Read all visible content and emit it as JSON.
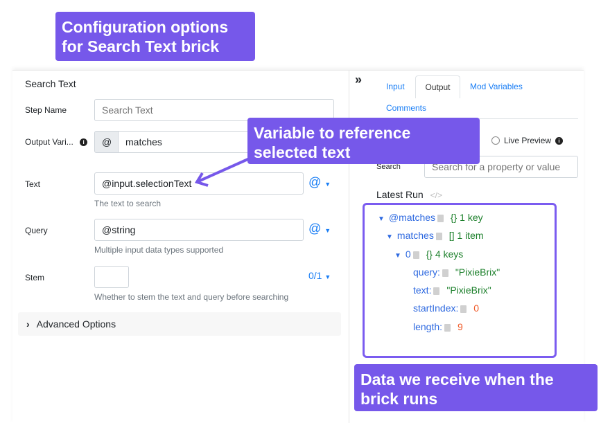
{
  "annotations": {
    "config": "Configuration options for Search Text brick",
    "variable": "Variable to reference selected text",
    "data": "Data we receive when the brick runs"
  },
  "brick": {
    "title": "Search Text",
    "fields": {
      "step_name": {
        "label": "Step Name",
        "placeholder": "Search Text"
      },
      "output_var": {
        "label": "Output Vari...",
        "prefix": "@",
        "value": "matches"
      },
      "text": {
        "label": "Text",
        "value": "@input.selectionText",
        "help": "The text to search",
        "type_button": "@"
      },
      "query": {
        "label": "Query",
        "value": "@string",
        "help": "Multiple input data types supported",
        "type_button": "@"
      },
      "stem": {
        "label": "Stem",
        "help": "Whether to stem the text and query before searching",
        "type_button": "0/1"
      }
    },
    "advanced": "Advanced Options"
  },
  "sidebar": {
    "collapse": "»",
    "tabs": [
      "Input",
      "Output",
      "Mod Variables",
      "Comments"
    ],
    "active_tab": "Output",
    "live_preview": "Live Preview",
    "search_label": "Search",
    "search_placeholder": "Search for a property or value",
    "latest_run": "Latest Run",
    "tree": {
      "root": "@matches",
      "root_meta": "{} 1 key",
      "matches": "matches",
      "matches_meta": "[] 1 item",
      "idx": "0",
      "idx_meta": "{} 4 keys",
      "query_key": "query:",
      "query_val": "\"PixieBrix\"",
      "text_key": "text:",
      "text_val": "\"PixieBrix\"",
      "start_key": "startIndex:",
      "start_val": "0",
      "length_key": "length:",
      "length_val": "9"
    }
  },
  "colors": {
    "accent": "#7658ea",
    "link": "#1a7ef5"
  }
}
